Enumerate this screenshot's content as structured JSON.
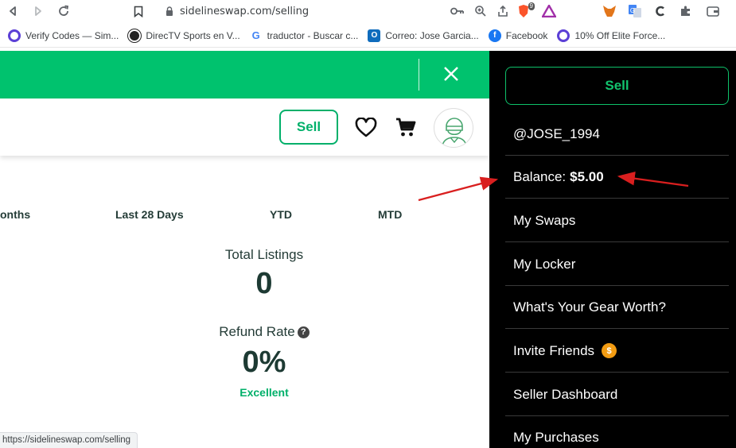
{
  "browser": {
    "url": "sidelineswap.com/selling",
    "status_url": "https://sidelineswap.com/selling",
    "extension_badge": "9",
    "bookmarks": [
      {
        "label": "Verify Codes — Sim...",
        "icon": "circle-c-icon",
        "color": "#5b3fd6"
      },
      {
        "label": "DirecTV Sports en V...",
        "icon": "soccer-ball-icon",
        "color": "#222222"
      },
      {
        "label": "traductor - Buscar c...",
        "icon": "google-g-icon",
        "color": "#4285f4"
      },
      {
        "label": "Correo: Jose Garcia...",
        "icon": "outlook-icon",
        "color": "#0f6cbd"
      },
      {
        "label": "Facebook",
        "icon": "facebook-icon",
        "color": "#1877f2"
      },
      {
        "label": "10% Off Elite Force...",
        "icon": "circle-c-icon",
        "color": "#5b3fd6"
      }
    ]
  },
  "header": {
    "sell_label": "Sell"
  },
  "filters": [
    "onths",
    "Last 28 Days",
    "YTD",
    "MTD"
  ],
  "stats": {
    "total_listings_label": "Total Listings",
    "total_listings_value": "0",
    "refund_rate_label": "Refund Rate",
    "refund_help": "?",
    "refund_rate_value": "0%",
    "refund_rating": "Excellent"
  },
  "side_menu": {
    "sell_label": "Sell",
    "username": "@JOSE_1994",
    "balance_label": "Balance:",
    "balance_value": "$5.00",
    "items": [
      "My Swaps",
      "My Locker",
      "What's Your Gear Worth?",
      "Invite Friends",
      "Seller Dashboard",
      "My Purchases"
    ],
    "invite_badge": "$"
  },
  "colors": {
    "brand_green": "#00c26e",
    "menu_bg": "#000000",
    "annotation_arrow": "#d91f1f"
  }
}
